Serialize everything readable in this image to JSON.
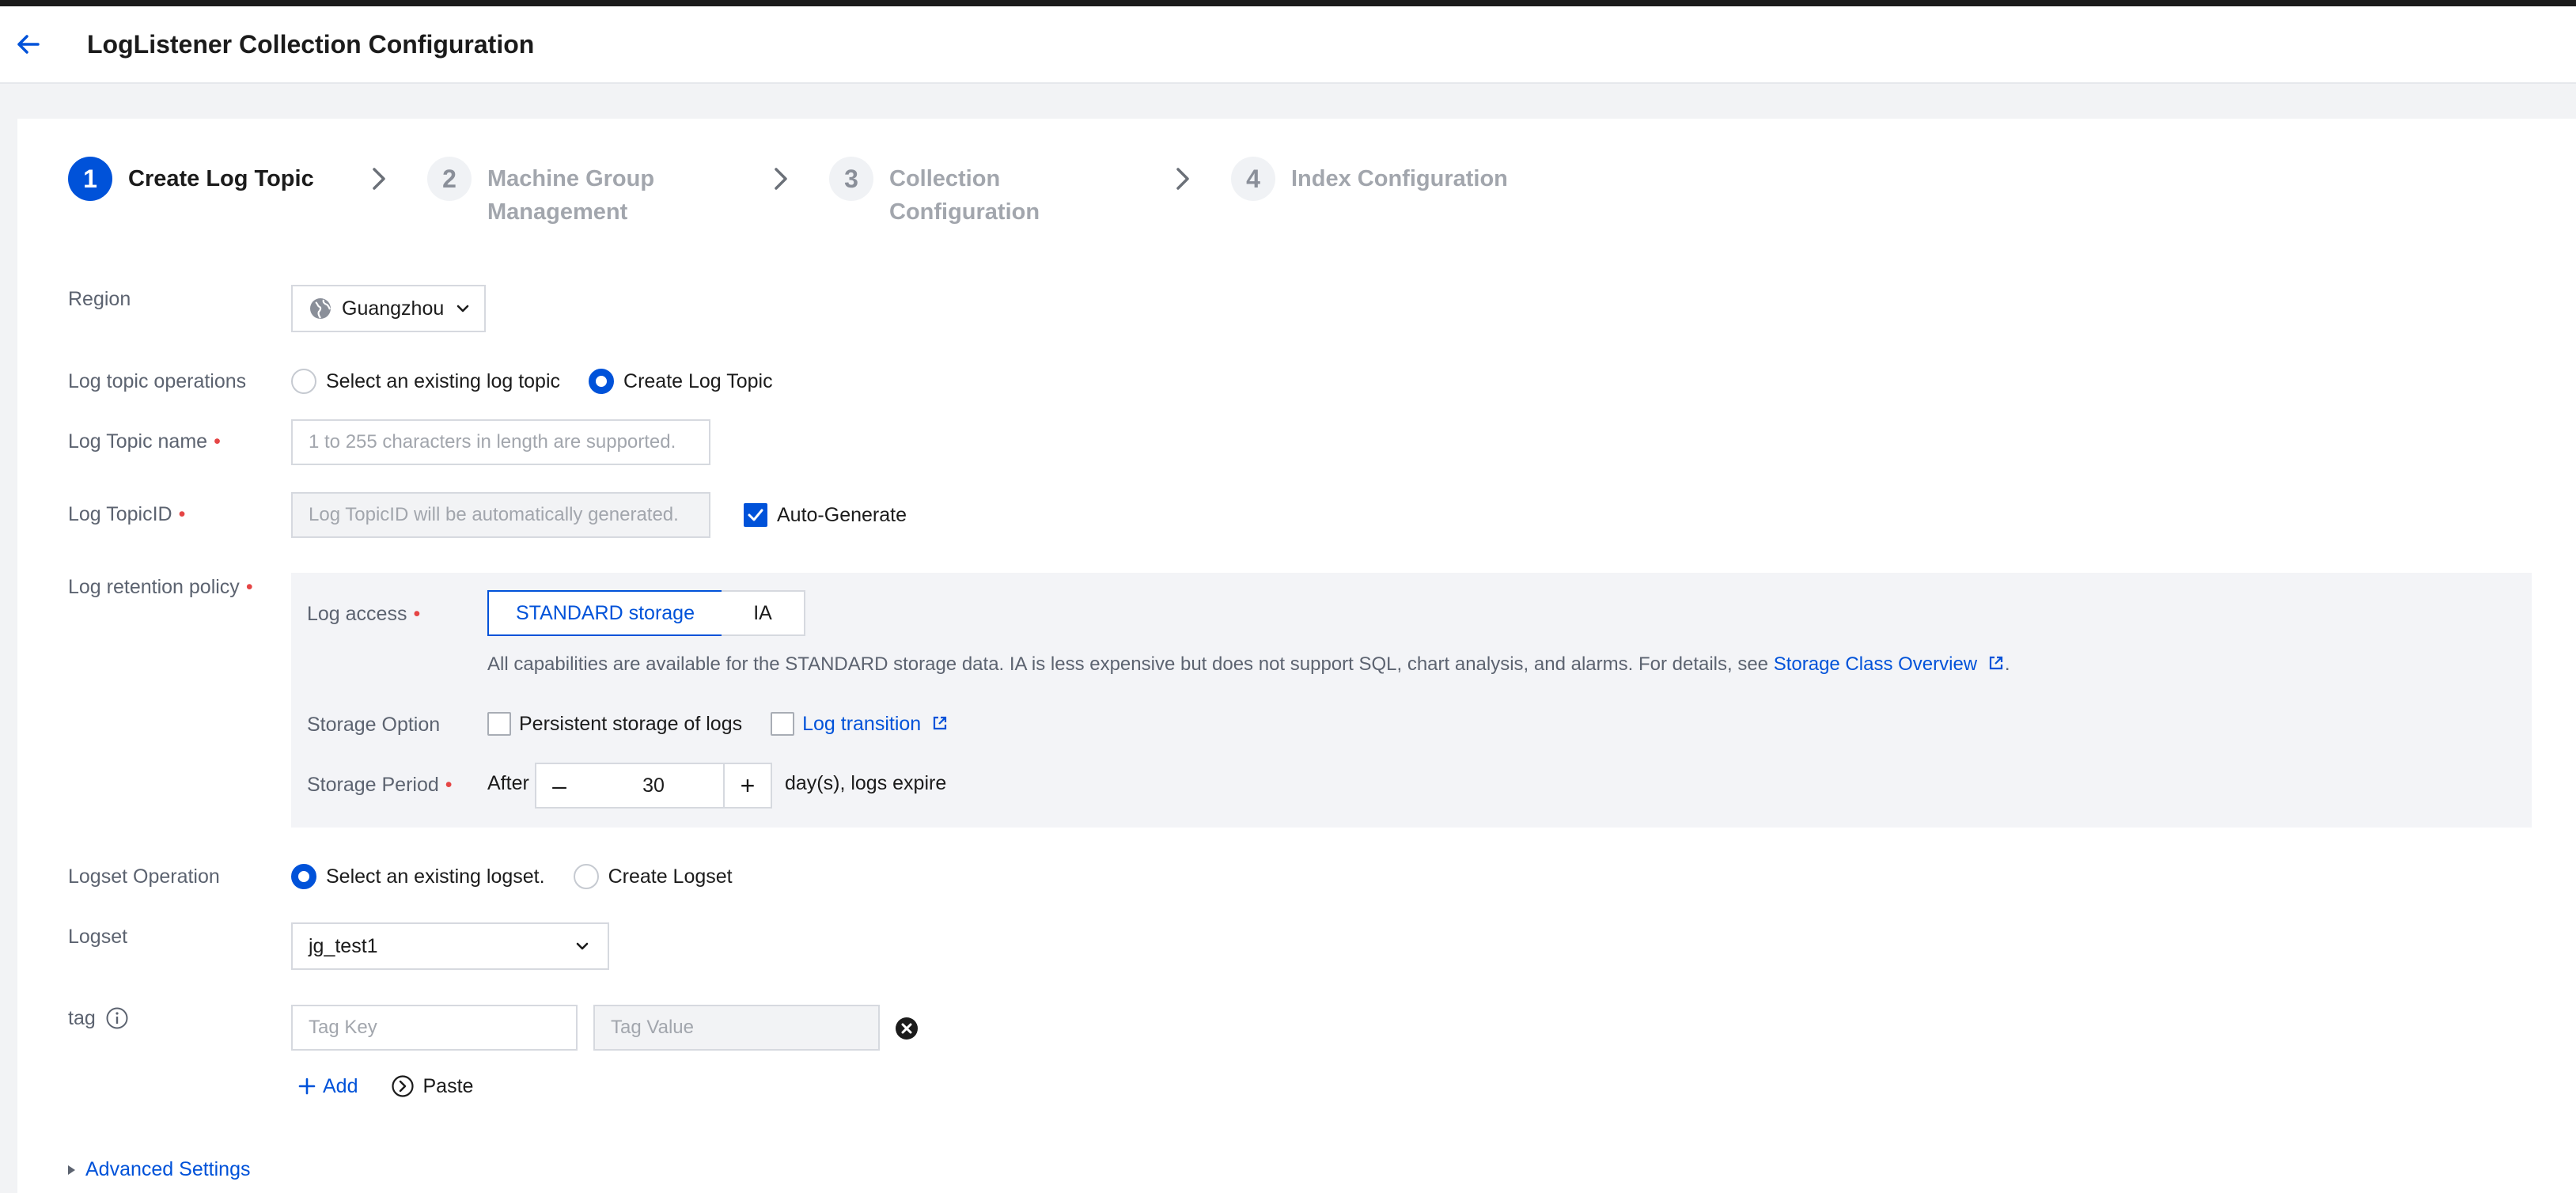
{
  "header": {
    "title": "LogListener Collection Configuration"
  },
  "steps": [
    {
      "number": "1",
      "line1": "Create Log Topic",
      "line2": ""
    },
    {
      "number": "2",
      "line1": "Machine Group",
      "line2": "Management"
    },
    {
      "number": "3",
      "line1": "Collection",
      "line2": "Configuration"
    },
    {
      "number": "4",
      "line1": "Index Configuration",
      "line2": ""
    }
  ],
  "region": {
    "label": "Region",
    "value": "Guangzhou"
  },
  "topic_ops": {
    "label": "Log topic operations",
    "option_existing": "Select an existing log topic",
    "option_create": "Create Log Topic",
    "selected": "create"
  },
  "topic_name": {
    "label": "Log Topic name",
    "placeholder": "1 to 255 characters in length are supported."
  },
  "topic_id": {
    "label": "Log TopicID",
    "placeholder": "Log TopicID will be automatically generated.",
    "auto_label": "Auto-Generate",
    "auto_checked": true
  },
  "retention": {
    "label": "Log retention policy",
    "access_label": "Log access",
    "access_options": [
      "STANDARD storage",
      "IA"
    ],
    "access_selected": "STANDARD storage",
    "desc": "All capabilities are available for the STANDARD storage data. IA is less expensive but does not support SQL, chart analysis, and alarms. For details, see ",
    "desc_link": "Storage Class Overview",
    "desc_end": ".",
    "storage_option_label": "Storage Option",
    "persistent_label": "Persistent storage of logs",
    "transition_label": "Log transition",
    "period_label": "Storage Period",
    "period_prefix": "After",
    "period_minus": "–",
    "period_value": "30",
    "period_plus": "+",
    "period_suffix": "day(s), logs expire"
  },
  "logset_ops": {
    "label": "Logset Operation",
    "option_existing": "Select an existing logset.",
    "option_create": "Create Logset",
    "selected": "existing"
  },
  "logset": {
    "label": "Logset",
    "value": "jg_test1"
  },
  "tag": {
    "label": "tag",
    "key_placeholder": "Tag Key",
    "value_placeholder": "Tag Value",
    "add_label": "Add",
    "paste_label": "Paste"
  },
  "advanced": {
    "label": "Advanced Settings"
  },
  "colors": {
    "primary": "#0052d9",
    "required": "#e54545"
  }
}
